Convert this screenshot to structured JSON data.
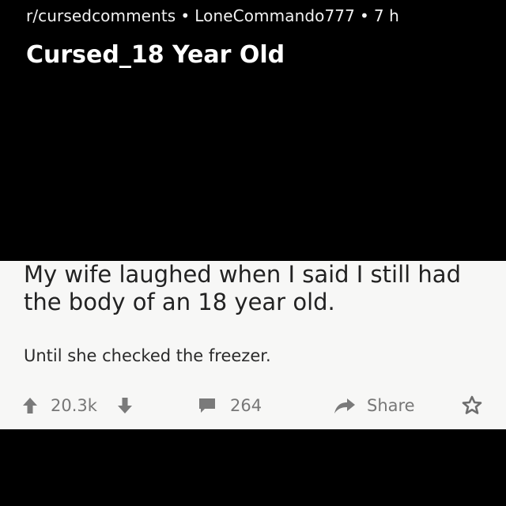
{
  "header": {
    "subreddit": "r/cursedcomments",
    "author": "LoneCommando777",
    "age": "7 h",
    "separator": "•",
    "title": "Cursed_18 Year Old"
  },
  "post": {
    "line1": "My wife laughed when I said I still had",
    "line2": "the body of an 18 year old.",
    "punchline": "Until she checked the freezer."
  },
  "actions": {
    "upvote_icon": "arrow-up-icon",
    "score": "20.3k",
    "downvote_icon": "arrow-down-icon",
    "comment_icon": "comment-bubble-icon",
    "comments": "264",
    "share_icon": "share-arrow-icon",
    "share_label": "Share",
    "award_icon": "award-icon"
  },
  "colors": {
    "background": "#000000",
    "card": "#f7f7f6",
    "text": "#222222",
    "action_gray": "#777777"
  }
}
